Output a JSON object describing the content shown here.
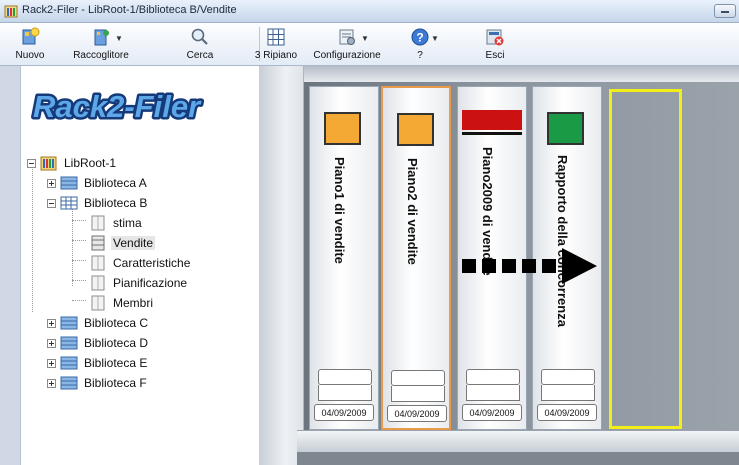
{
  "window": {
    "title": "Rack2-Filer - LibRoot-1/Biblioteca B/Vendite"
  },
  "toolbar": {
    "nuovo": "Nuovo",
    "raccoglitore": "Raccoglitore",
    "cerca": "Cerca",
    "ripiano": "3 Ripiano",
    "configurazione": "Configurazione",
    "help": "?",
    "esci": "Esci"
  },
  "logo": {
    "text": "Rack2-Filer"
  },
  "tree": {
    "root": "LibRoot-1",
    "lib_a": "Biblioteca A",
    "lib_b": "Biblioteca B",
    "stima": "stima",
    "vendite": "Vendite",
    "caratteristiche": "Caratteristiche",
    "pianificazione": "Pianificazione",
    "membri": "Membri",
    "lib_c": "Biblioteca C",
    "lib_d": "Biblioteca D",
    "lib_e": "Biblioteca E",
    "lib_f": "Biblioteca F"
  },
  "binders": [
    {
      "title": "Piano1 di vendite",
      "date": "04/09/2009",
      "color": "#f4a935"
    },
    {
      "title": "Piano2 di vendite",
      "date": "04/09/2009",
      "color": "#f4a935"
    },
    {
      "title": "Piano2009 di vendite",
      "date": "04/09/2009",
      "color": "#cc1111"
    },
    {
      "title": "Rapporto della concorrenza",
      "date": "04/09/2009",
      "color": "#1a9a44"
    }
  ],
  "colors": {
    "highlight_slot": "#f2ef18",
    "selected_binder": "#e89a4a"
  }
}
